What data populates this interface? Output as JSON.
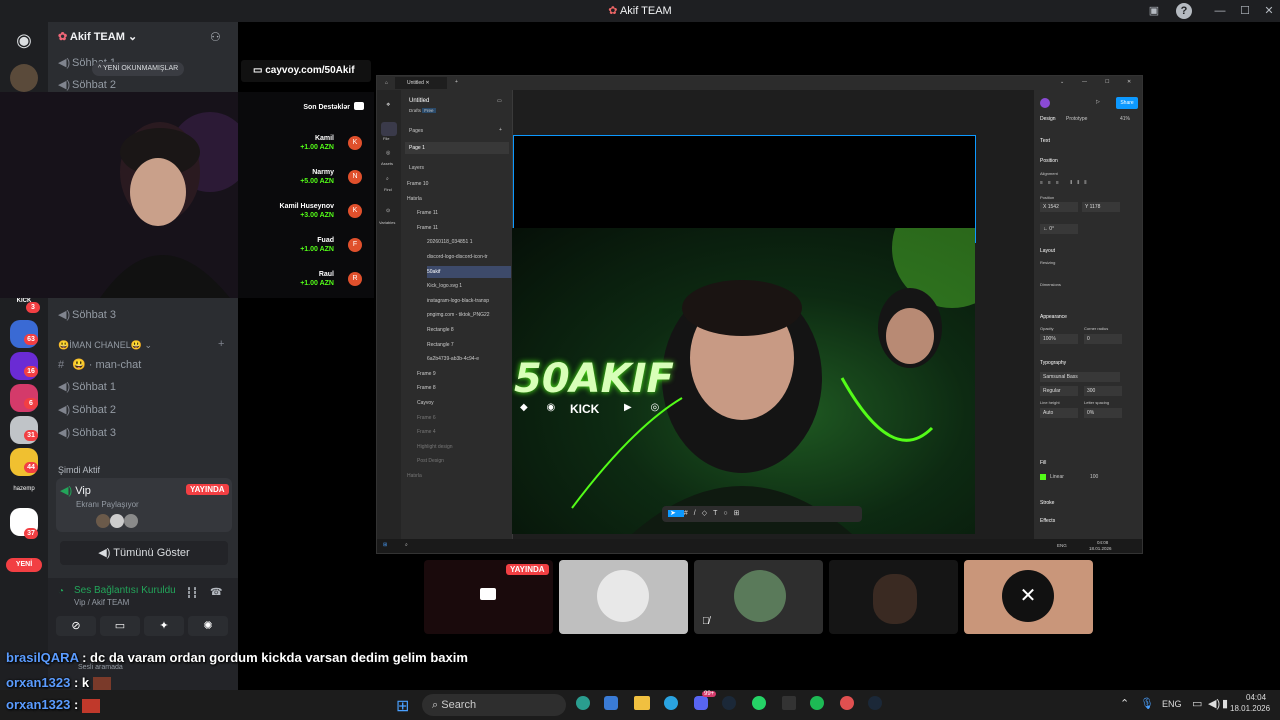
{
  "window": {
    "title": "Akif TEAM"
  },
  "server": {
    "name": "Akif TEAM",
    "unread_pill": "YENİ OKUNMAMIŞLAR",
    "channels_top": [
      "Söhbat 1",
      "Söhbat 2"
    ],
    "channel_s3a": "Söhbat 3",
    "category": "İMAN CHANEL",
    "text_channel": "man-chat",
    "voice_channels": [
      "Söhbat 1",
      "Söhbat 2",
      "Söhbat 3"
    ],
    "active_now_heading": "Şimdi Aktif",
    "active_channel": "Vip",
    "active_badge": "YAYINDA",
    "active_sub": "Ekranı Paylaşıyor",
    "show_all": "Tümünü Göster"
  },
  "server_rail": {
    "badges": [
      "3",
      "63",
      "16",
      "6",
      "31",
      "44",
      "37"
    ],
    "new_label": "YENİ",
    "hazemp": "hazemp"
  },
  "voice_status": {
    "title": "Ses Bağlantısı Kuruldu",
    "sub": "Vip / Akif TEAM",
    "sesli": "Sesli aramada"
  },
  "overlay": {
    "url": "cayvoy.com/50Akif",
    "donations_title": "Son Destəklər",
    "donations": [
      {
        "name": "Kamil",
        "amount": "+1.00 AZN",
        "initial": "K"
      },
      {
        "name": "Narmy",
        "amount": "+5.00 AZN",
        "initial": "N"
      },
      {
        "name": "Kamil Huseynov",
        "amount": "+3.00 AZN",
        "initial": "K"
      },
      {
        "name": "Fuad",
        "amount": "+1.00 AZN",
        "initial": "F"
      },
      {
        "name": "Raul",
        "amount": "+1.00 AZN",
        "initial": "R"
      }
    ]
  },
  "figma": {
    "tab": "Untitled",
    "file": "Untitled",
    "drafts": "Drafts",
    "free": "Free",
    "pages_heading": "Pages",
    "page1": "Page 1",
    "layers_heading": "Layers",
    "layers": [
      "Frame 10",
      "Hatırla",
      "Frame 11",
      "Frame 11",
      "20260118_034851 1",
      "discord-logo-discord-icon-tr",
      "50akif",
      "Kick_logo.svg 1",
      "instagram-logo-black-transp",
      "pngimg.com - tiktok_PNG22",
      "Rectangle 8",
      "Rectangle 7",
      "6a2b4739-ab3b-4c94-e",
      "Frame 9",
      "Frame 8",
      "Cayvoy",
      "Frame 6",
      "Frame 4",
      "Highlight design",
      "Post Design",
      "Hatırla"
    ],
    "left_tools": [
      "File",
      "Assets",
      "Find",
      "Variables"
    ],
    "share": "Share",
    "design_tab": "Design",
    "prototype_tab": "Prototype",
    "zoom": "41%",
    "props": {
      "text": "Text",
      "position": "Position",
      "alignment": "Alignment",
      "pos_x": "1542",
      "pos_y": "1178",
      "rotation": "0°",
      "layout": "Layout",
      "resizing": "Resizing",
      "dimensions": "Dimensions",
      "appearance": "Appearance",
      "opacity_label": "Opacity",
      "opacity": "100%",
      "corner_radius": "Corner radius",
      "corner_value": "0",
      "typography": "Typography",
      "font": "Samsunal Bass",
      "weight": "Regular",
      "size": "300",
      "line_height_label": "Line height",
      "line_height": "Auto",
      "letter_spacing_label": "Letter spacing",
      "letter_spacing": "0%",
      "fill": "Fill",
      "fill_type": "Linear",
      "fill_opacity": "100",
      "stroke": "Stroke",
      "effects": "Effects"
    },
    "canvas_text": "50AKIF",
    "canvas_kick": "KICK"
  },
  "inner_taskbar": {
    "lang": "ENG",
    "time": "04:08",
    "date": "18.01.2026"
  },
  "tiles": {
    "live_badge": "YAYINDA"
  },
  "chat": [
    {
      "user": "brasilQARA",
      "text": "dc da varam ordan gordum kickda varsan dedim gelim baxim"
    },
    {
      "user": "orxan1323",
      "text": "k"
    },
    {
      "user": "orxan1323",
      "text": ""
    }
  ],
  "taskbar": {
    "search": "Search",
    "lang": "ENG",
    "time": "04:04",
    "date": "18.01.2026",
    "steam_badge": "99+"
  },
  "colors": {
    "discord_bg": "#2b2d31",
    "rail_bg": "#1e1f22",
    "live_red": "#f23f43",
    "green": "#23a55a",
    "figma_blue": "#0d99ff",
    "kick_green": "#53fc18"
  }
}
